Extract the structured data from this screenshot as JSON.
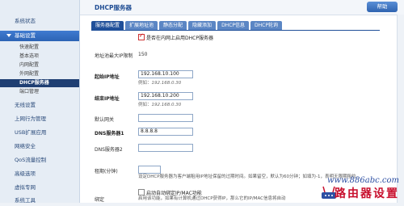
{
  "sidebar": {
    "items": [
      {
        "label": "系统状态",
        "type": "normal"
      },
      {
        "label": "基础设置",
        "type": "group"
      },
      {
        "label": "快速配置",
        "type": "sub"
      },
      {
        "label": "基本选项",
        "type": "sub"
      },
      {
        "label": "内网配置",
        "type": "sub"
      },
      {
        "label": "外网配置",
        "type": "sub"
      },
      {
        "label": "DHCP服务器",
        "type": "active"
      },
      {
        "label": "端口管理",
        "type": "sub"
      },
      {
        "label": "无线设置",
        "type": "normal"
      },
      {
        "label": "上网行为管理",
        "type": "normal"
      },
      {
        "label": "USB扩展应用",
        "type": "normal"
      },
      {
        "label": "网络安全",
        "type": "normal"
      },
      {
        "label": "QoS流量控制",
        "type": "normal"
      },
      {
        "label": "高级选项",
        "type": "normal"
      },
      {
        "label": "虚拟专网",
        "type": "normal"
      },
      {
        "label": "系统工具",
        "type": "normal"
      }
    ]
  },
  "header": {
    "title": "DHCP服务器",
    "help_label": "帮助"
  },
  "tabs": [
    {
      "label": "服务器配置",
      "active": true
    },
    {
      "label": "扩展地址池",
      "active": false
    },
    {
      "label": "静态分配",
      "active": false
    },
    {
      "label": "隐藏添加",
      "active": false
    },
    {
      "label": "DHCP信息",
      "active": false
    },
    {
      "label": "DHCP轮询",
      "active": false
    }
  ],
  "form": {
    "enable_label": "是否在内网上启用DHCP服务器",
    "enable_checked": true,
    "pool_size_label": "地址池最大IP限制",
    "pool_size_value": "150",
    "start_ip_label": "起始IP地址",
    "start_ip_value": "192.168.10.100",
    "start_ip_example_prefix": "例如：",
    "start_ip_example": "192.168.0.30",
    "end_ip_label": "结束IP地址",
    "end_ip_value": "192.168.10.200",
    "end_ip_example_prefix": "例如：",
    "end_ip_example": "192.168.0.30",
    "gateway_label": "默认网关",
    "gateway_value": "",
    "dns1_label": "DNS服务器1",
    "dns1_value": "8.8.8.8",
    "dns2_label": "DNS服务器2",
    "dns2_value": "",
    "lease_label": "租期(分钟)",
    "lease_value": "",
    "lease_desc": "设定DHCP服务器为客户端租用IP地址保留的过期时间。如果留空，默认为60分钟；如填为-1，表明无限期租约。",
    "bind_label": "绑定",
    "bind_checkbox_label": "启动自动绑定IP/MAC功能",
    "bind_desc": "启用该功能，如果有计算机通过DHCP获得IP，那么它的IP/MAC信息将自动"
  },
  "watermark": {
    "url": "www.886abc.com",
    "text": "路由器设置"
  },
  "colors": {
    "accent": "#1f4f99",
    "sidebar_active": "#1f3f73",
    "watermark_red": "#c8102e",
    "watermark_blue": "#2d4fa3"
  }
}
